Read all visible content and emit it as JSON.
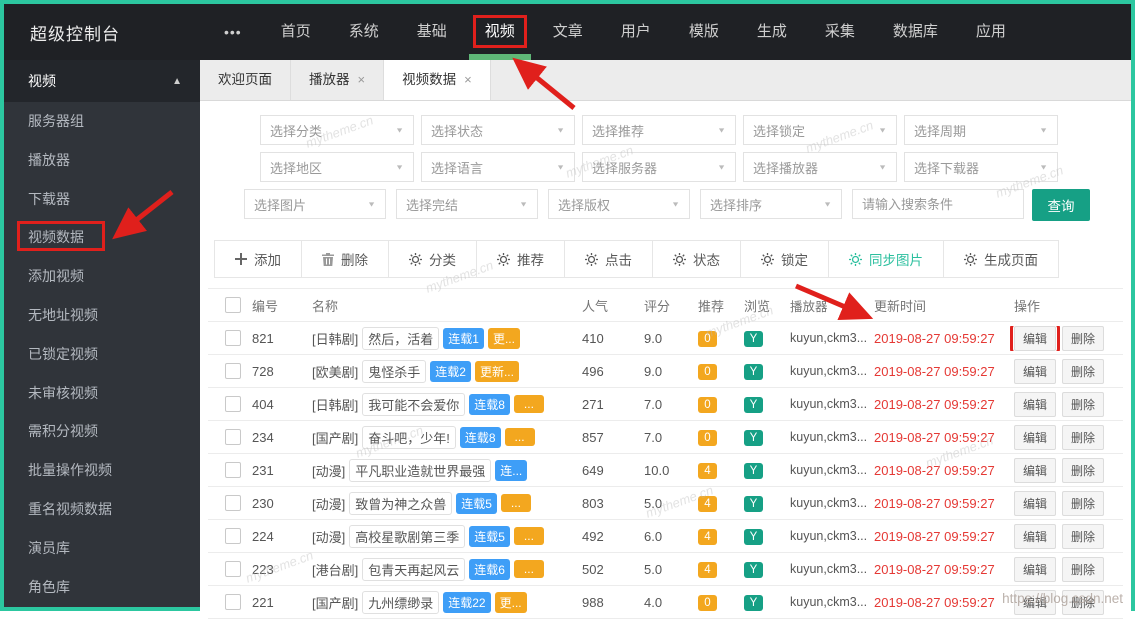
{
  "topbar": {
    "title": "超级控制台",
    "nav": [
      {
        "label": "首页"
      },
      {
        "label": "系统"
      },
      {
        "label": "基础"
      },
      {
        "label": "视频",
        "active": true
      },
      {
        "label": "文章"
      },
      {
        "label": "用户"
      },
      {
        "label": "模版"
      },
      {
        "label": "生成"
      },
      {
        "label": "采集"
      },
      {
        "label": "数据库"
      },
      {
        "label": "应用"
      }
    ]
  },
  "icons": {
    "more": "•••",
    "collapse": "▲",
    "caret": "▼",
    "close": "×"
  },
  "sidebar": {
    "header": {
      "label": "视频"
    },
    "items": [
      {
        "label": "服务器组"
      },
      {
        "label": "播放器"
      },
      {
        "label": "下载器"
      },
      {
        "label": "视频数据",
        "boxed": true
      },
      {
        "label": "添加视频"
      },
      {
        "label": "无地址视频"
      },
      {
        "label": "已锁定视频"
      },
      {
        "label": "未审核视频"
      },
      {
        "label": "需积分视频"
      },
      {
        "label": "批量操作视频"
      },
      {
        "label": "重名视频数据"
      },
      {
        "label": "演员库"
      },
      {
        "label": "角色库"
      }
    ]
  },
  "tabs": [
    {
      "label": "欢迎页面",
      "closable": false
    },
    {
      "label": "播放器",
      "closable": true
    },
    {
      "label": "视频数据",
      "closable": true,
      "active": true
    }
  ],
  "filters": {
    "row1": [
      {
        "label": "选择分类"
      },
      {
        "label": "选择状态"
      },
      {
        "label": "选择推荐"
      },
      {
        "label": "选择锁定"
      },
      {
        "label": "选择周期"
      }
    ],
    "row2": [
      {
        "label": "选择地区"
      },
      {
        "label": "选择语言"
      },
      {
        "label": "选择服务器"
      },
      {
        "label": "选择播放器"
      },
      {
        "label": "选择下载器"
      }
    ],
    "row3": [
      {
        "label": "选择图片"
      },
      {
        "label": "选择完结"
      },
      {
        "label": "选择版权"
      },
      {
        "label": "选择排序"
      }
    ],
    "search_placeholder": "请输入搜索条件",
    "search_button": "查询"
  },
  "toolbar": {
    "add_label": "添加",
    "delete_label": "删除",
    "gear_buttons": [
      {
        "label": "分类"
      },
      {
        "label": "推荐"
      },
      {
        "label": "点击"
      },
      {
        "label": "状态"
      },
      {
        "label": "锁定"
      },
      {
        "label": "同步图片",
        "green": true
      },
      {
        "label": "生成页面"
      }
    ]
  },
  "table": {
    "headers": [
      "编号",
      "名称",
      "人气",
      "评分",
      "推荐",
      "浏览",
      "播放器",
      "更新时间",
      "操作"
    ],
    "edit_label": "编辑",
    "delete_label": "删除",
    "rows": [
      {
        "id": "821",
        "category": "[日韩剧]",
        "title": "然后，活着",
        "serial": "连载1",
        "extra": "更...",
        "views": "410",
        "score": "9.0",
        "rec": "0",
        "browse": "Y",
        "player": "kuyun,ckm3...",
        "time": "2019-08-27 09:59:27"
      },
      {
        "id": "728",
        "category": "[欧美剧]",
        "title": "鬼怪杀手",
        "serial": "连载2",
        "extra": "更新...",
        "views": "496",
        "score": "9.0",
        "rec": "0",
        "browse": "Y",
        "player": "kuyun,ckm3...",
        "time": "2019-08-27 09:59:27"
      },
      {
        "id": "404",
        "category": "[日韩剧]",
        "title": "我可能不会爱你",
        "serial": "连载8",
        "extra": "...",
        "views": "271",
        "score": "7.0",
        "rec": "0",
        "browse": "Y",
        "player": "kuyun,ckm3...",
        "time": "2019-08-27 09:59:27"
      },
      {
        "id": "234",
        "category": "[国产剧]",
        "title": "奋斗吧，少年!",
        "serial": "连载8",
        "extra": "...",
        "views": "857",
        "score": "7.0",
        "rec": "0",
        "browse": "Y",
        "player": "kuyun,ckm3...",
        "time": "2019-08-27 09:59:27"
      },
      {
        "id": "231",
        "category": "[动漫]",
        "title": "平凡职业造就世界最强",
        "serial": "连...",
        "extra": null,
        "views": "649",
        "score": "10.0",
        "rec": "4",
        "browse": "Y",
        "player": "kuyun,ckm3...",
        "time": "2019-08-27 09:59:27"
      },
      {
        "id": "230",
        "category": "[动漫]",
        "title": "致曾为神之众兽",
        "serial": "连载5",
        "extra": "...",
        "views": "803",
        "score": "5.0",
        "rec": "4",
        "browse": "Y",
        "player": "kuyun,ckm3...",
        "time": "2019-08-27 09:59:27"
      },
      {
        "id": "224",
        "category": "[动漫]",
        "title": "高校星歌剧第三季",
        "serial": "连载5",
        "extra": "...",
        "views": "492",
        "score": "6.0",
        "rec": "4",
        "browse": "Y",
        "player": "kuyun,ckm3...",
        "time": "2019-08-27 09:59:27"
      },
      {
        "id": "223",
        "category": "[港台剧]",
        "title": "包青天再起风云",
        "serial": "连载6",
        "extra": "...",
        "views": "502",
        "score": "5.0",
        "rec": "4",
        "browse": "Y",
        "player": "kuyun,ckm3...",
        "time": "2019-08-27 09:59:27"
      },
      {
        "id": "221",
        "category": "[国产剧]",
        "title": "九州缥缈录",
        "serial": "连载22",
        "extra": "更...",
        "views": "988",
        "score": "4.0",
        "rec": "0",
        "browse": "Y",
        "player": "kuyun,ckm3...",
        "time": "2019-08-27 09:59:27"
      }
    ]
  },
  "watermarks": {
    "site": "mytheme.cn",
    "csdn": "https://blog.csdn.net"
  },
  "colors": {
    "frame_accent": "#2cc7a0",
    "topbar_bg": "#1f2125",
    "sidebar_bg": "#30343a",
    "active_underline_green": "#5FB878",
    "primary_button_green": "#16a085",
    "badge_blue": "#3e9ef7",
    "badge_orange": "#f3a71f",
    "time_red": "#e53935",
    "annotation_red": "#e0201c"
  }
}
